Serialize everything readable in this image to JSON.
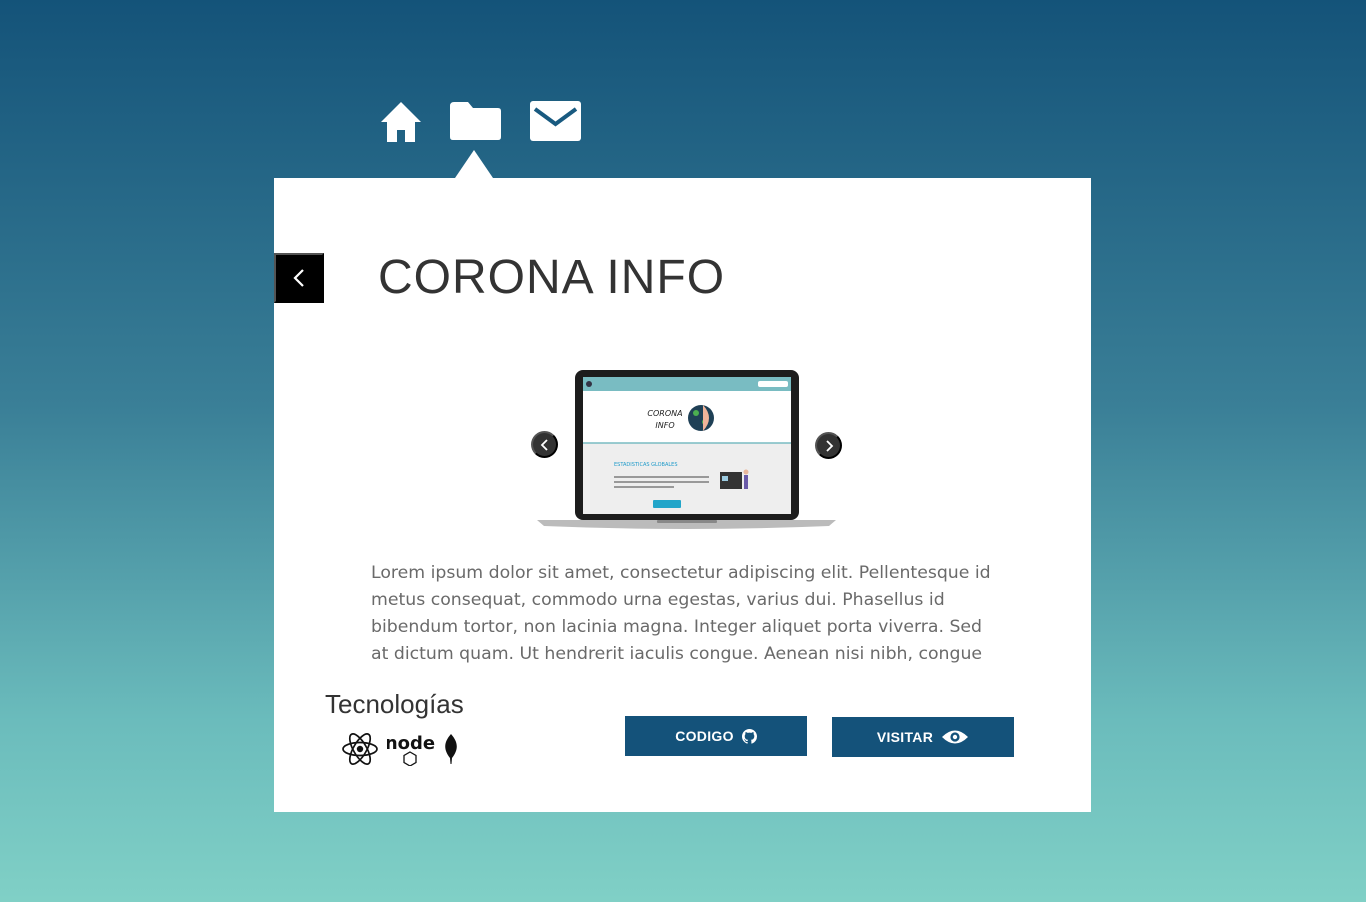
{
  "nav": {
    "items": [
      {
        "icon": "home-icon",
        "label": "Home"
      },
      {
        "icon": "folder-icon",
        "label": "Projects",
        "active": true
      },
      {
        "icon": "mail-icon",
        "label": "Contact"
      }
    ]
  },
  "project": {
    "title": "CORONA INFO",
    "screenshot": {
      "brand": "CORONA INFO",
      "section": "ESTADISTICAS GLOBALES"
    },
    "description": "Lorem ipsum dolor sit amet, consectetur adipiscing elit. Pellentesque id metus consequat, commodo urna egestas, varius dui. Phasellus id bibendum tortor, non lacinia magna. Integer aliquet porta viverra. Sed at dictum quam. Ut hendrerit iaculis congue. Aenean nisi nibh, congue",
    "technologies_title": "Tecnologías",
    "technologies": [
      {
        "icon": "react-icon"
      },
      {
        "icon": "nodejs-icon",
        "text": "node"
      },
      {
        "icon": "mongodb-icon"
      }
    ]
  },
  "buttons": {
    "code_label": "CODIGO",
    "visit_label": "VISITAR"
  },
  "colors": {
    "background_top": "#145379",
    "background_bottom": "#80d0c6",
    "button": "#14527a",
    "card": "#ffffff"
  }
}
